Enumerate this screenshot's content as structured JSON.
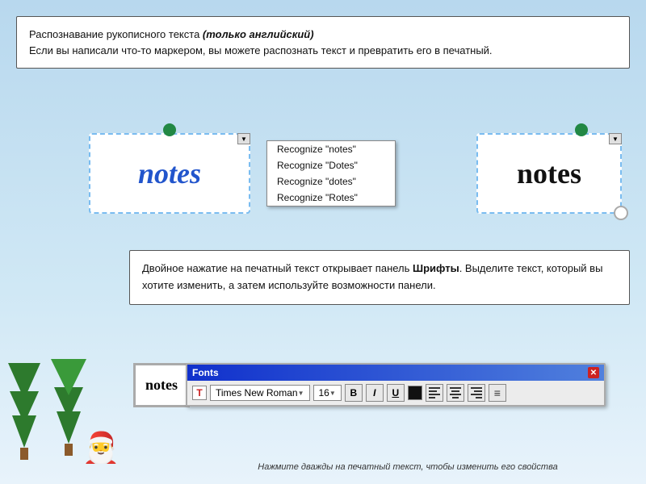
{
  "background": {
    "color_top": "#b8d8ee",
    "color_bottom": "#d8ecf8"
  },
  "info_box_top": {
    "line1": "Распознавание рукописного текста ",
    "line1_italic": "(только английский)",
    "line2": "Если вы написали что-то маркером, вы можете распознать текст и превратить его в печатный."
  },
  "recognition": {
    "handwritten_word": "notes",
    "printed_word": "notes",
    "menu_items": [
      "Recognize \"notes\"",
      "Recognize \"Dotes\"",
      "Recognize \"dotes\"",
      "Recognize \"Rotes\""
    ]
  },
  "info_box_bottom": {
    "text": "Двойное нажатие на печатный текст открывает панель ",
    "bold_word": "Шрифты",
    "text2": ". Выделите текст, который вы хотите изменить, а затем используйте возможности панели."
  },
  "fonts_toolbar": {
    "title": "Fonts",
    "close_label": "✕",
    "font_icon_label": "T",
    "font_name": "Times New Roman",
    "font_size": "16",
    "bold_label": "B",
    "italic_label": "I",
    "underline_label": "U",
    "dropdown_arrow": "▼"
  },
  "caption": {
    "text": "Нажмите дважды на печатный текст, чтобы изменить его свойства"
  },
  "notes_label": {
    "text": "notes"
  }
}
